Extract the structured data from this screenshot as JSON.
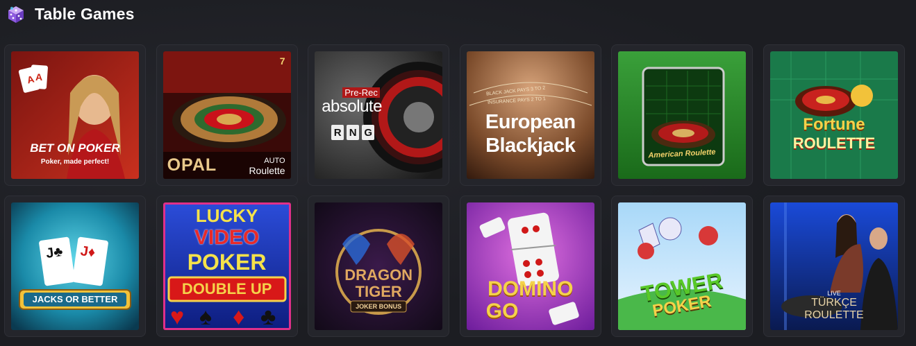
{
  "section": {
    "title": "Table Games",
    "icon": "dice-icon"
  },
  "games": [
    {
      "id": "bet-on-poker",
      "title": "BET ON POKER",
      "subtitle": "Poker, made perfect!"
    },
    {
      "id": "opal-auto-roulette",
      "title": "OPAL",
      "subtitle_line1": "AUTO",
      "subtitle_line2": "Roulette",
      "badge": "7"
    },
    {
      "id": "absolute-rng",
      "badge": "Pre-Rec",
      "title": "absolute",
      "letters": [
        "R",
        "N",
        "G"
      ]
    },
    {
      "id": "european-blackjack",
      "line1": "European",
      "line2": "Blackjack",
      "felt_line1": "BLACK JACK PAYS 3 TO 2",
      "felt_line2": "INSURANCE PAYS 2 TO 1"
    },
    {
      "id": "american-roulette",
      "title": "American Roulette"
    },
    {
      "id": "fortune-roulette",
      "line1": "Fortune",
      "line2": "ROULETTE"
    },
    {
      "id": "jacks-or-better",
      "title": "JACKS OR BETTER"
    },
    {
      "id": "lucky-video-poker",
      "line1": "LUCKY",
      "line2": "VIDEO",
      "line3": "POKER",
      "line4": "DOUBLE UP"
    },
    {
      "id": "dragon-tiger",
      "line1": "DRAGON",
      "line2": "TIGER",
      "line3": "JOKER BONUS"
    },
    {
      "id": "domino-go",
      "line1": "DOMINO",
      "line2": "GO"
    },
    {
      "id": "tower-poker",
      "line1": "TOWER",
      "line2": "POKER"
    },
    {
      "id": "live-turkce-roulette",
      "line1": "LIVE",
      "line2": "TÜRKÇE",
      "line3": "ROULETTE"
    }
  ]
}
